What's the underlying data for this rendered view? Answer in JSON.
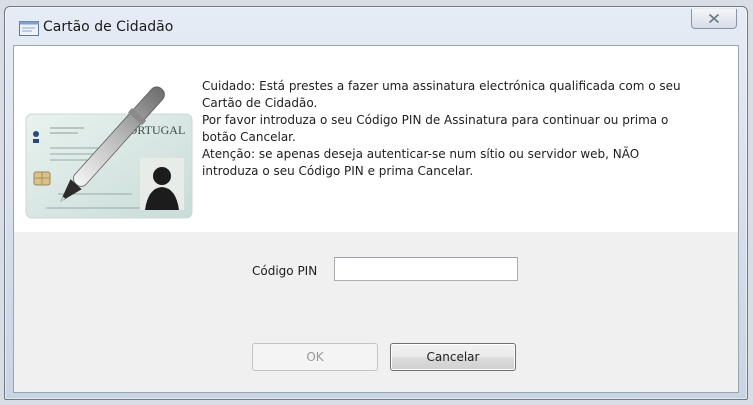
{
  "window": {
    "title": "Cartão de Cidadão",
    "title_icon": "window-app-icon",
    "close_icon": "close-icon"
  },
  "message": {
    "paragraphs": [
      "Cuidado: Está prestes a fazer uma assinatura electrónica qualificada com o seu\nCartão de Cidadão.",
      "Por favor introduza o seu Código PIN de Assinatura para continuar ou prima o\nbotão Cancelar.",
      "Atenção: se apenas deseja autenticar-se num sítio ou servidor web, NÃO\nintroduza o seu Código PIN e prima Cancelar."
    ]
  },
  "card_image": {
    "icon": "citizen-card-with-pen-icon",
    "card_text": "PORTUGAL"
  },
  "form": {
    "pin_label": "Código PIN",
    "pin_value": ""
  },
  "buttons": {
    "ok_label": "OK",
    "ok_enabled": false,
    "cancel_label": "Cancelar"
  },
  "colors": {
    "titlebar": "#dbe3ee",
    "panel_white": "#ffffff",
    "dialog_gray": "#f0f0f0",
    "disabled_text": "#9a9a9a"
  }
}
